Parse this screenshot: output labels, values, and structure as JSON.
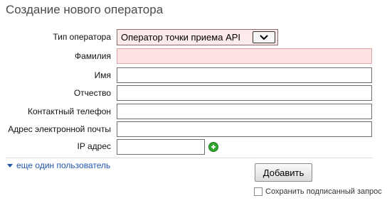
{
  "page": {
    "title": "Создание нового оператора"
  },
  "form": {
    "operator_type": {
      "label": "Тип оператора",
      "selected": "Оператор точки приема API"
    },
    "last_name": {
      "label": "Фамилия",
      "value": ""
    },
    "first_name": {
      "label": "Имя",
      "value": ""
    },
    "middle_name": {
      "label": "Отчество",
      "value": ""
    },
    "phone": {
      "label": "Контактный телефон",
      "value": ""
    },
    "email": {
      "label": "Адрес электронной почты",
      "value": ""
    },
    "ip": {
      "label": "IP адрес",
      "value": ""
    }
  },
  "actions": {
    "add_user_link": "еще один пользователь",
    "submit_label": "Добавить",
    "save_signed_label": "Сохранить подписанный запрос"
  },
  "colors": {
    "error_field_bg": "#fde3e3",
    "link": "#2255aa",
    "add_icon": "#2fa52f"
  }
}
